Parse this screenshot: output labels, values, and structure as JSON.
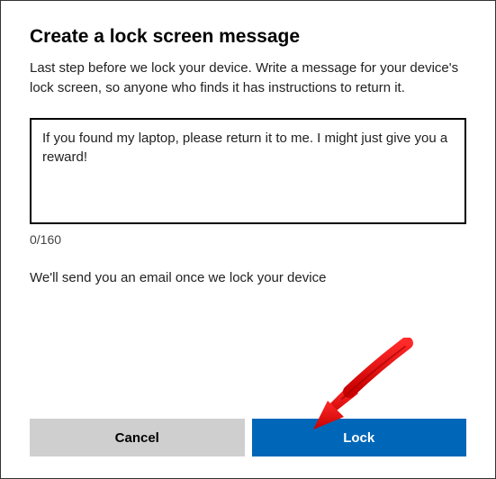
{
  "dialog": {
    "title": "Create a lock screen message",
    "description": "Last step before we lock your device. Write a message for your device's lock screen, so anyone who finds it has instructions to return it.",
    "message_value": "If you found my laptop, please return it to me. I might just give you a reward!",
    "counter": "0/160",
    "email_note": "We'll send you an email once we lock your device",
    "cancel_label": "Cancel",
    "lock_label": "Lock"
  }
}
